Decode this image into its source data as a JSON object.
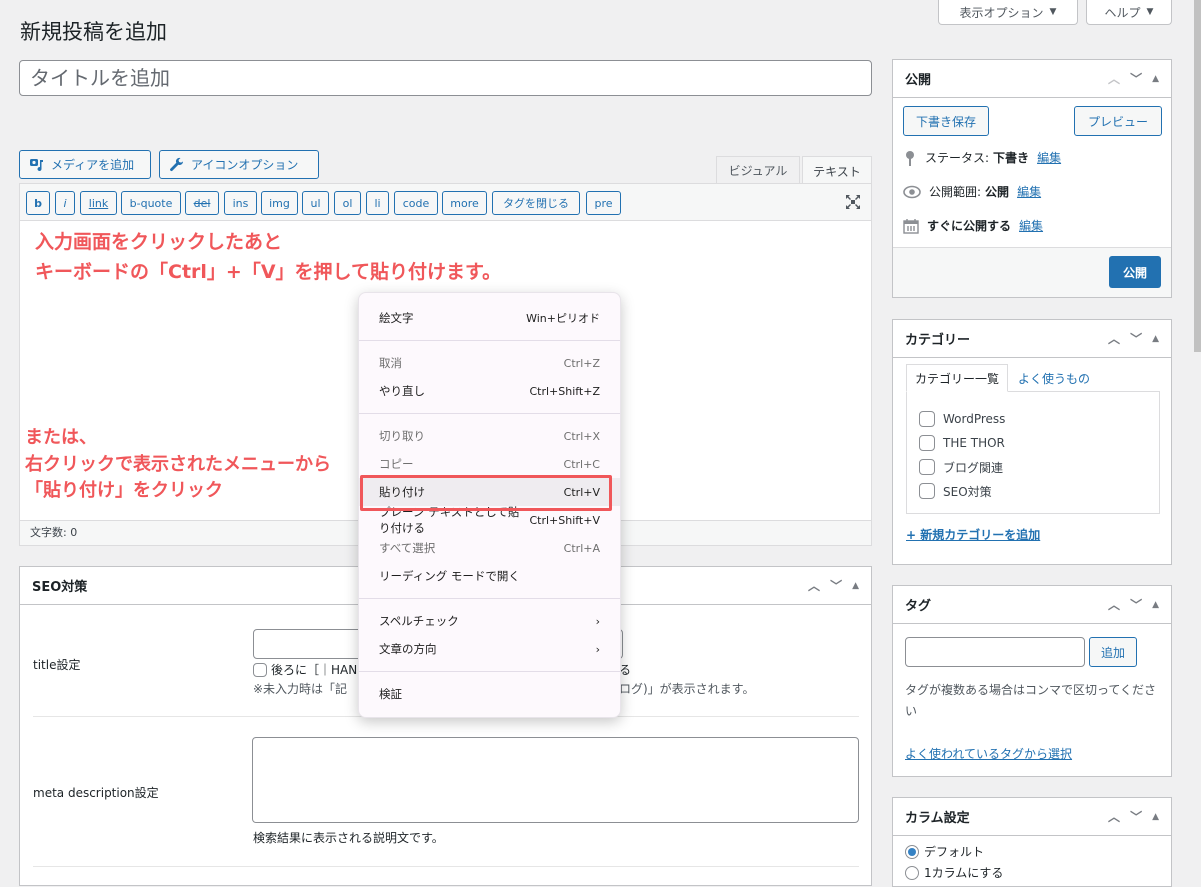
{
  "header": {
    "screen_options": "表示オプション",
    "help": "ヘルプ",
    "page_title": "新規投稿を追加"
  },
  "editor": {
    "title_placeholder": "タイトルを追加",
    "add_media": "メディアを追加",
    "icon_options": "アイコンオプション",
    "tabs": [
      {
        "label": "ビジュアル",
        "active": false
      },
      {
        "label": "テキスト",
        "active": true
      }
    ],
    "quicktags": [
      "b",
      "i",
      "link",
      "b-quote",
      "del",
      "ins",
      "img",
      "ul",
      "ol",
      "li",
      "code",
      "more",
      "タグを閉じる",
      "pre"
    ],
    "word_count": "文字数: 0"
  },
  "annotations": {
    "line1": "入力画面をクリックしたあと",
    "line2": "キーボードの「Ctrl」+「V」を押して貼り付けます。",
    "line3": "または、",
    "line4": "右クリックで表示されたメニューから",
    "line5": "「貼り付け」をクリック",
    "color": "#f0575a"
  },
  "context_menu": {
    "items": [
      {
        "label": "絵文字",
        "shortcut": "Win+ピリオド",
        "disabled": false
      },
      {
        "label": "取消",
        "shortcut": "Ctrl+Z",
        "disabled": true
      },
      {
        "label": "やり直し",
        "shortcut": "Ctrl+Shift+Z",
        "disabled": false
      },
      {
        "label": "切り取り",
        "shortcut": "Ctrl+X",
        "disabled": true
      },
      {
        "label": "コピー",
        "shortcut": "Ctrl+C",
        "disabled": true
      },
      {
        "label": "貼り付け",
        "shortcut": "Ctrl+V",
        "disabled": false,
        "highlighted": true
      },
      {
        "label": "プレーン テキストとして貼り付ける",
        "shortcut": "Ctrl+Shift+V",
        "disabled": false
      },
      {
        "label": "すべて選択",
        "shortcut": "Ctrl+A",
        "disabled": true
      },
      {
        "label": "リーディング モードで開く",
        "shortcut": "",
        "disabled": false
      },
      {
        "label": "スペルチェック",
        "shortcut": "›",
        "disabled": false
      },
      {
        "label": "文章の方向",
        "shortcut": "›",
        "disabled": false
      },
      {
        "label": "検証",
        "shortcut": "",
        "disabled": false
      }
    ]
  },
  "seo": {
    "title": "SEO対策",
    "title_label": "title設定",
    "title_checkbox_prefix": "後ろに［｜HAN",
    "title_checkbox_suffix": "る",
    "title_note_prefix": "※未入力時は「記",
    "title_note_suffix": "ログ)」が表示されます。",
    "meta_label": "meta description設定",
    "meta_note": "検索結果に表示される説明文です。"
  },
  "publish": {
    "title": "公開",
    "save_draft": "下書き保存",
    "preview": "プレビュー",
    "status_label": "ステータス:",
    "status_value": "下書き",
    "visibility_label": "公開範囲:",
    "visibility_value": "公開",
    "schedule_label": "すぐに公開する",
    "edit": "編集",
    "publish_button": "公開"
  },
  "categories": {
    "title": "カテゴリー",
    "tab_all": "カテゴリー一覧",
    "tab_popular": "よく使うもの",
    "items": [
      "WordPress",
      "THE THOR",
      "ブログ関連",
      "SEO対策"
    ],
    "add_new": "+ 新規カテゴリーを追加"
  },
  "tags": {
    "title": "タグ",
    "add": "追加",
    "help": "タグが複数ある場合はコンマで区切ってください",
    "choose": "よく使われているタグから選択"
  },
  "columns": {
    "title": "カラム設定",
    "option_default": "デフォルト",
    "option_one": "1カラムにする"
  }
}
